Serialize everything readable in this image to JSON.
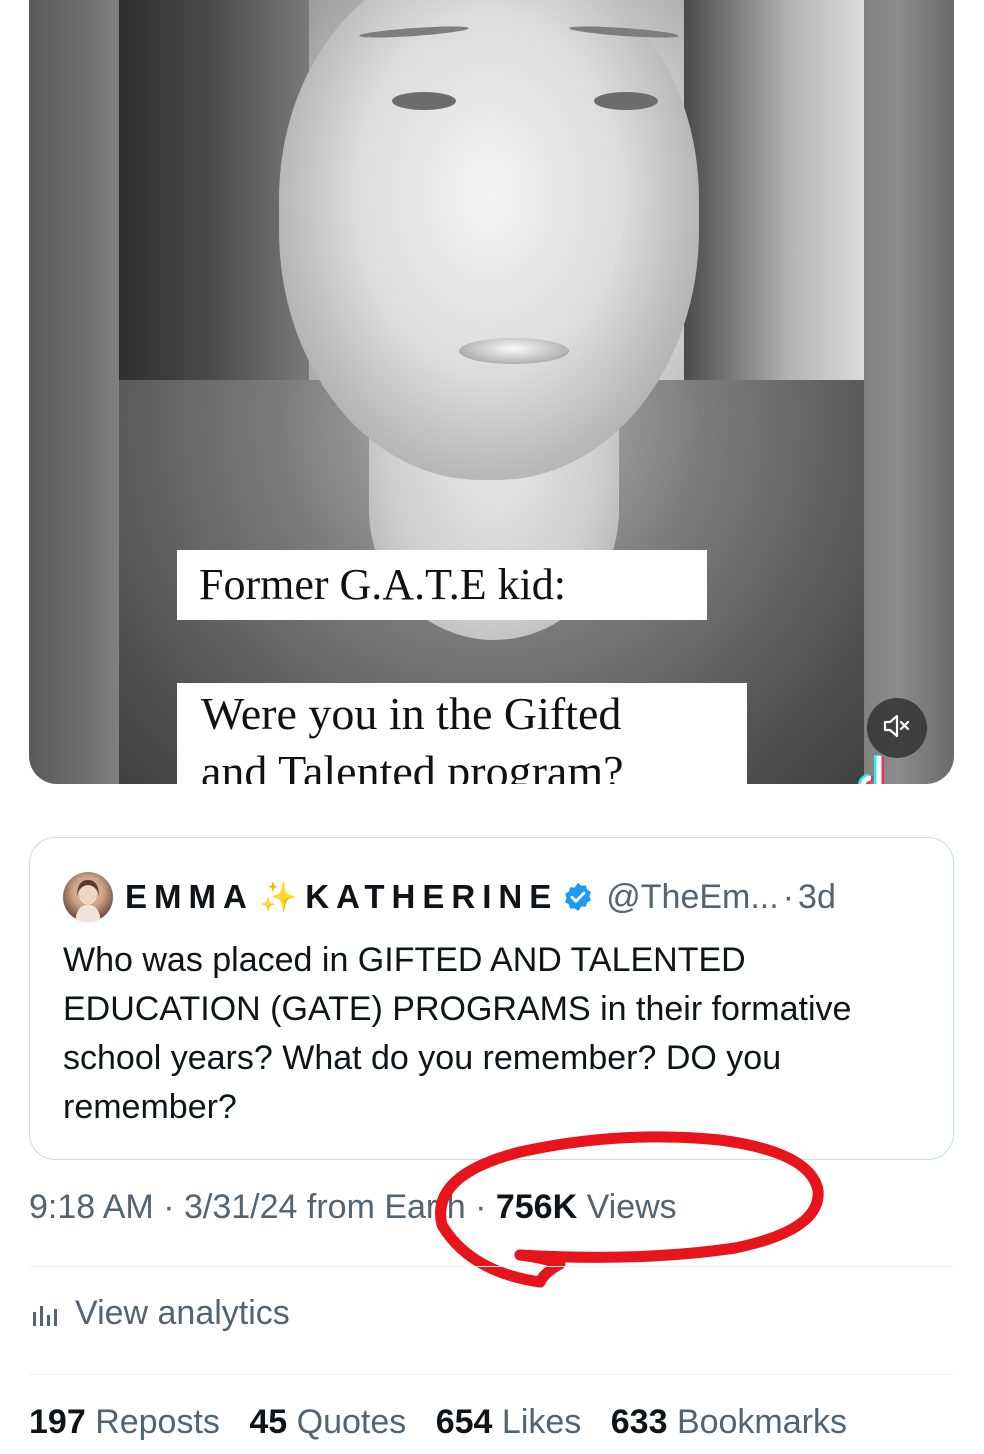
{
  "media": {
    "caption_line1": "Former G.A.T.E kid:",
    "caption_line2": "Were you in the Gifted",
    "caption_line3": "and Talented program?",
    "mute_icon": "volume-mute-icon",
    "watermark_icon": "tiktok-icon"
  },
  "quoted_tweet": {
    "display_name": "EMMA",
    "sparkle": "✨",
    "display_name_2": "KATHERINE",
    "handle": "@TheEm...",
    "separator": "·",
    "age": "3d",
    "text": "Who was placed in GIFTED AND TALENTED EDUCATION (GATE) PROGRAMS in their formative school years? What do you remember? DO you remember?",
    "verified_color": "#1d9bf0"
  },
  "meta": {
    "time": "9:18 AM",
    "date": "3/31/24",
    "source": "from Earth",
    "views_count": "756K",
    "views_label": "Views",
    "dot": "·"
  },
  "annotation": {
    "color": "#e8141b"
  },
  "analytics": {
    "label": "View analytics",
    "icon": "bar-chart-icon"
  },
  "stats": [
    {
      "count": "197",
      "label": "Reposts"
    },
    {
      "count": "45",
      "label": "Quotes"
    },
    {
      "count": "654",
      "label": "Likes"
    },
    {
      "count": "633",
      "label": "Bookmarks"
    }
  ]
}
